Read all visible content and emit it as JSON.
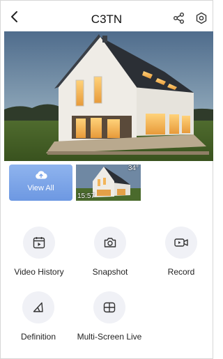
{
  "header": {
    "title": "C3TN"
  },
  "recordings": {
    "view_all_label": "View All",
    "thumbnail": {
      "time": "15:57",
      "temperature": "34°"
    }
  },
  "actions": [
    {
      "label": "Video History",
      "icon": "calendar-play-icon"
    },
    {
      "label": "Snapshot",
      "icon": "camera-icon"
    },
    {
      "label": "Record",
      "icon": "video-record-icon"
    },
    {
      "label": "Definition",
      "icon": "definition-icon"
    },
    {
      "label": "Multi-Screen Live",
      "icon": "grid-screen-icon"
    }
  ],
  "colors": {
    "accent": "#7aa3e8",
    "icon_bg": "#f0f1f6",
    "text": "#1a1a1a"
  }
}
